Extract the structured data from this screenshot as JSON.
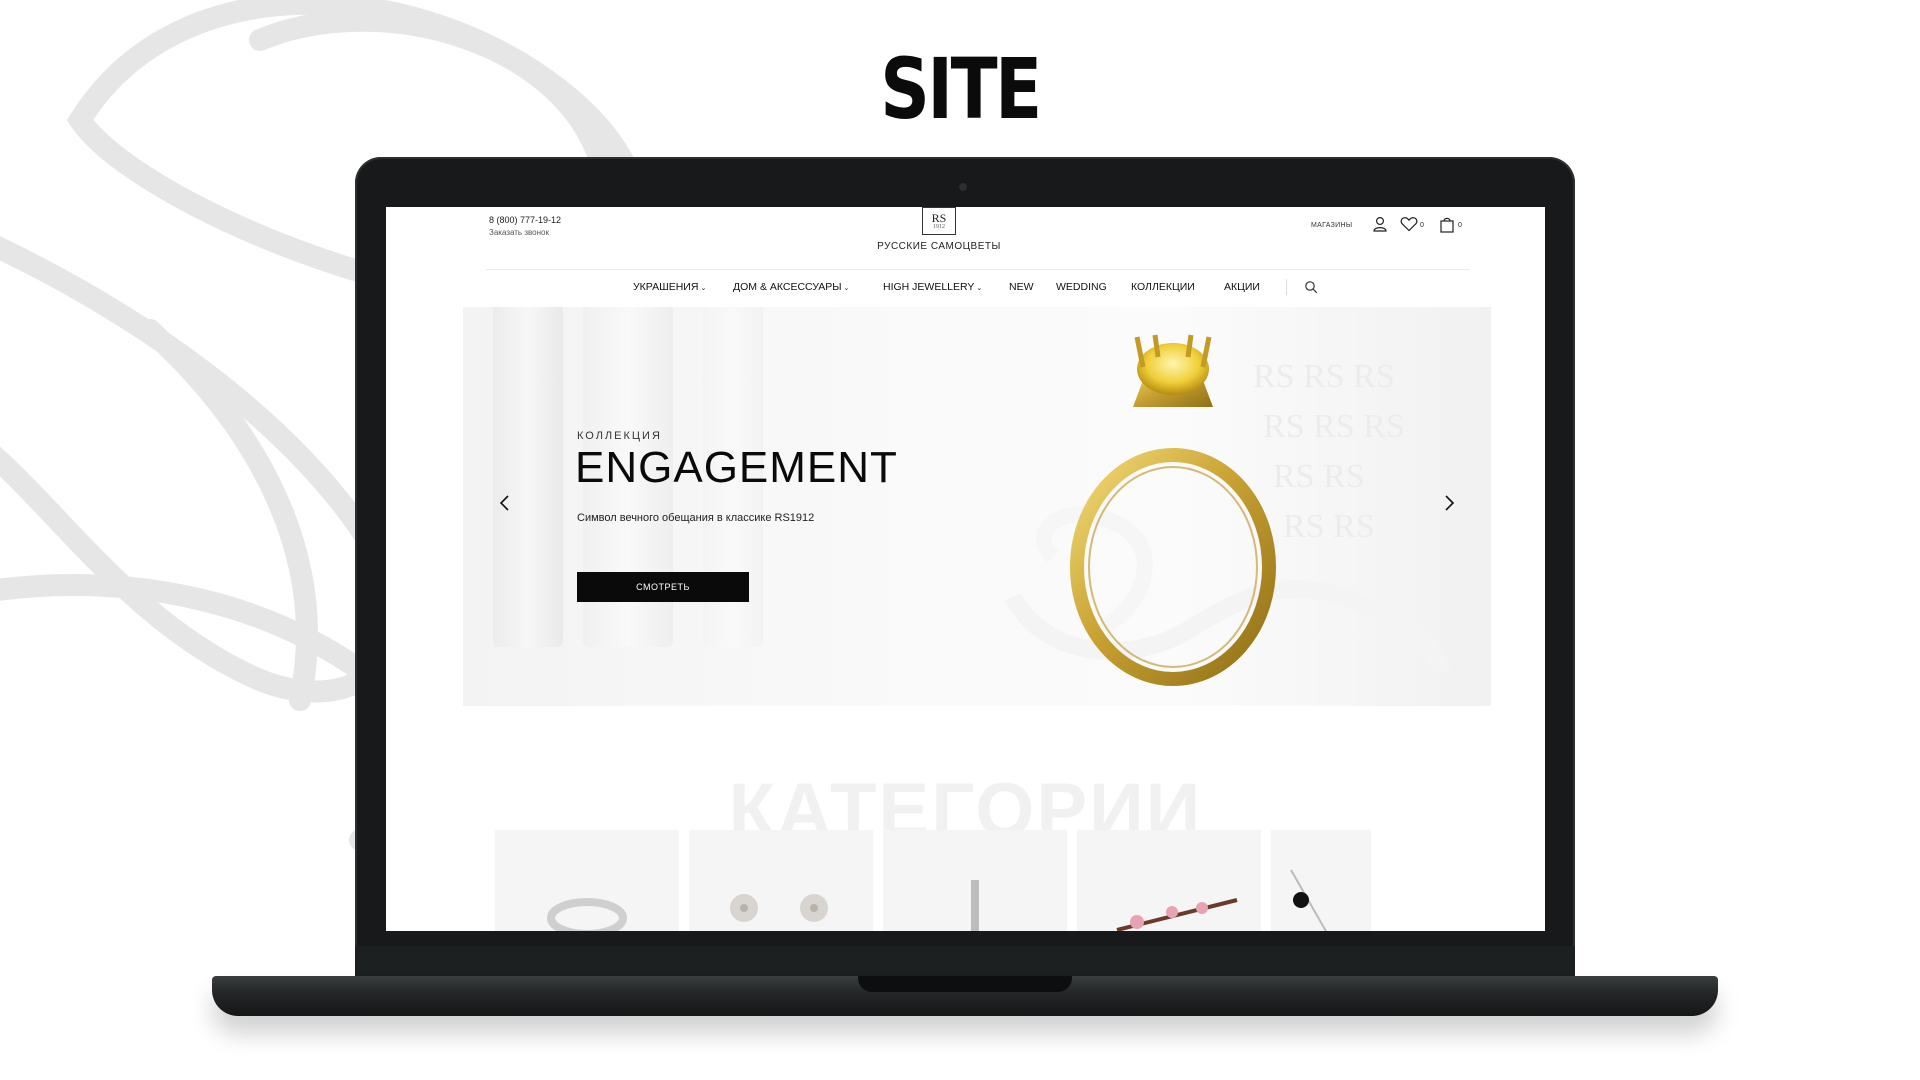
{
  "heading": "SITE",
  "site": {
    "header": {
      "phone": "8 (800) 777-19-12",
      "callback": "Заказать звонок",
      "logo_mark": "RS",
      "logo_year": "1912",
      "logo_name": "РУССКИЕ САМОЦВЕТЫ",
      "stores": "МАГАЗИНЫ",
      "wishlist_count": "0",
      "cart_count": "0",
      "icons": [
        "user-icon",
        "heart-icon",
        "bag-icon"
      ]
    },
    "nav": {
      "items": [
        {
          "label": "УКРАШЕНИЯ",
          "dropdown": true
        },
        {
          "label": "ДОМ & АКСЕССУАРЫ",
          "dropdown": true
        },
        {
          "label": "HIGH JEWELLERY",
          "dropdown": true
        },
        {
          "label": "NEW",
          "dropdown": false
        },
        {
          "label": "WEDDING",
          "dropdown": false
        },
        {
          "label": "КОЛЛЕКЦИИ",
          "dropdown": false
        },
        {
          "label": "АКЦИИ",
          "dropdown": false
        }
      ],
      "search_icon": "search-icon"
    },
    "hero": {
      "eyebrow": "КОЛЛЕКЦИЯ",
      "title": "ENGAGEMENT",
      "subtitle": "Символ вечного обещания в классике RS1912",
      "button": "СМОТРЕТЬ"
    },
    "categories": {
      "title": "КАТЕГОРИИ"
    }
  }
}
